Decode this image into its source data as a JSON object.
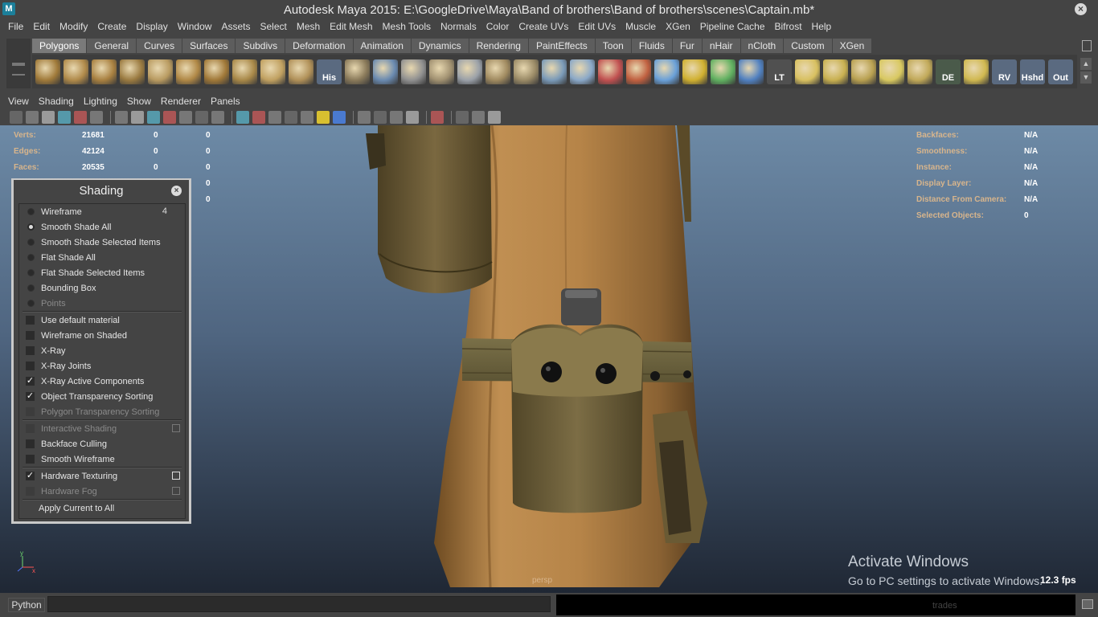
{
  "window": {
    "title": "Autodesk Maya 2015: E:\\GoogleDrive\\Maya\\Band of brothers\\Band of brothers\\scenes\\Captain.mb*",
    "app_icon": "maya-logo-icon",
    "close_icon": "close-icon"
  },
  "menubar": [
    "File",
    "Edit",
    "Modify",
    "Create",
    "Display",
    "Window",
    "Assets",
    "Select",
    "Mesh",
    "Edit Mesh",
    "Mesh Tools",
    "Normals",
    "Color",
    "Create UVs",
    "Edit UVs",
    "Muscle",
    "XGen",
    "Pipeline Cache",
    "Bifrost",
    "Help"
  ],
  "shelf": {
    "tabs": [
      "Polygons",
      "General",
      "Curves",
      "Surfaces",
      "Subdivs",
      "Deformation",
      "Animation",
      "Dynamics",
      "Rendering",
      "PaintEffects",
      "Toon",
      "Fluids",
      "Fur",
      "nHair",
      "nCloth",
      "Custom",
      "XGen"
    ],
    "active_tab": "Polygons",
    "text_icons": {
      "history": "His",
      "lt": "LT",
      "de": "DE",
      "rv": "RV",
      "hshd": "Hshd",
      "out": "Out"
    }
  },
  "panel_menu": [
    "View",
    "Shading",
    "Lighting",
    "Show",
    "Renderer",
    "Panels"
  ],
  "hud": {
    "left": [
      {
        "label": "Verts:",
        "v1": "21681",
        "v2": "0",
        "v3": "0"
      },
      {
        "label": "Edges:",
        "v1": "42124",
        "v2": "0",
        "v3": "0"
      },
      {
        "label": "Faces:",
        "v1": "20535",
        "v2": "0",
        "v3": "0"
      }
    ],
    "left_extra": [
      "0",
      "0"
    ],
    "right": [
      {
        "label": "Backfaces:",
        "value": "N/A"
      },
      {
        "label": "Smoothness:",
        "value": "N/A"
      },
      {
        "label": "Instance:",
        "value": "N/A"
      },
      {
        "label": "Display Layer:",
        "value": "N/A"
      },
      {
        "label": "Distance From Camera:",
        "value": "N/A"
      },
      {
        "label": "Selected Objects:",
        "value": "0"
      }
    ],
    "camera": "persp",
    "fps": "12.3 fps",
    "axis_y": "y",
    "axis_x": "x"
  },
  "watermark": {
    "line1": "Activate Windows",
    "line2": "Go to PC settings to activate Windows."
  },
  "shading_dialog": {
    "title": "Shading",
    "radio_items": [
      {
        "label": "Wireframe",
        "on": false,
        "hotkey": "4"
      },
      {
        "label": "Smooth Shade All",
        "on": true
      },
      {
        "label": "Smooth Shade Selected Items",
        "on": false
      },
      {
        "label": "Flat Shade All",
        "on": false
      },
      {
        "label": "Flat Shade Selected Items",
        "on": false
      },
      {
        "label": "Bounding Box",
        "on": false
      },
      {
        "label": "Points",
        "on": false,
        "disabled": true
      }
    ],
    "check_items_a": [
      {
        "label": "Use default material",
        "checked": false
      },
      {
        "label": "Wireframe on Shaded",
        "checked": false
      },
      {
        "label": "X-Ray",
        "checked": false
      },
      {
        "label": "X-Ray Joints",
        "checked": false
      },
      {
        "label": "X-Ray Active Components",
        "checked": true
      },
      {
        "label": "Object Transparency Sorting",
        "checked": true
      },
      {
        "label": "Polygon Transparency Sorting",
        "checked": false,
        "disabled": true
      }
    ],
    "check_items_b": [
      {
        "label": "Interactive Shading",
        "checked": false,
        "disabled": true,
        "option": true
      },
      {
        "label": "Backface Culling",
        "checked": false
      },
      {
        "label": "Smooth Wireframe",
        "checked": false
      }
    ],
    "check_items_c": [
      {
        "label": "Hardware Texturing",
        "checked": true,
        "option": true
      },
      {
        "label": "Hardware Fog",
        "checked": false,
        "disabled": true,
        "option": true
      }
    ],
    "apply_label": "Apply Current to All"
  },
  "bottom": {
    "python_label": "Python",
    "result_faded": "trades"
  },
  "colors": {
    "hud_label": "#d8b58c",
    "viewport_top": "#6d8aa6",
    "viewport_bottom": "#1f2734",
    "coat": "#b98a4f",
    "canteen": "#6b5f3a"
  }
}
